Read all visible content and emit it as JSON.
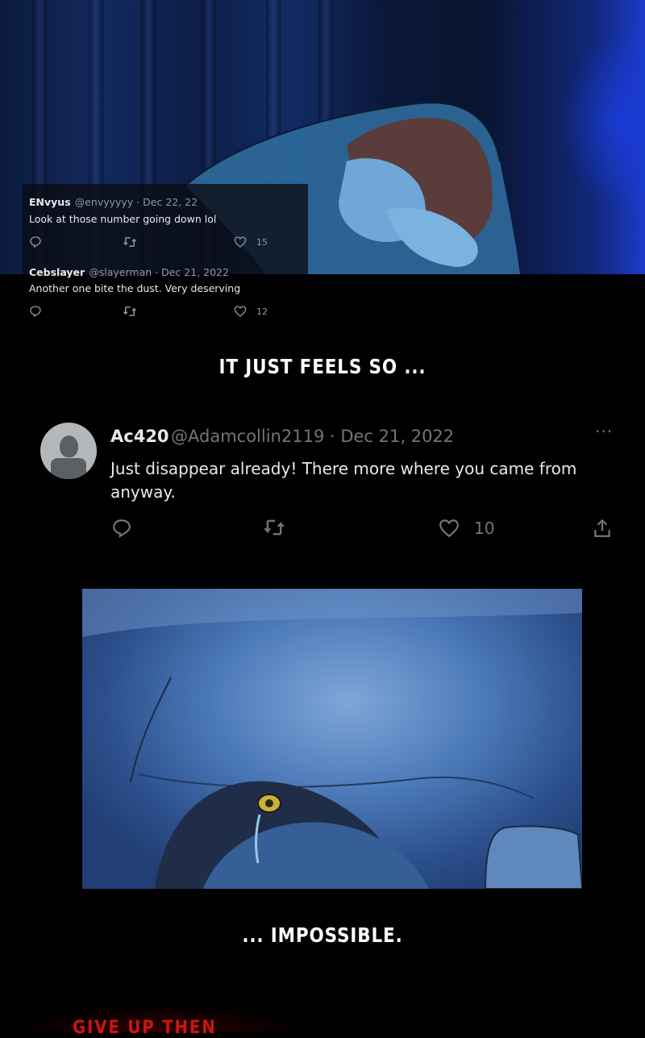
{
  "tweet_small_1": {
    "name": "ENvyus",
    "meta": "@envyyyyy · Dec 22, 22",
    "text": "Look at those number going down lol",
    "like_count": "15"
  },
  "tweet_small_2": {
    "name": "Cebslayer",
    "meta": "@slayerman · Dec 21, 2022",
    "text": "Another one bite the dust. Very deserving",
    "like_count": "12"
  },
  "caption_1": "IT JUST FEELS SO ...",
  "tweet_big": {
    "name": "Ac420",
    "meta": "@Adamcollin2119 · Dec 21, 2022",
    "more": "···",
    "text": "Just disappear already! There more where you came from anyway.",
    "like_count": "10"
  },
  "caption_2": "... IMPOSSIBLE.",
  "bottom_red_text": "GIVE UP THEN",
  "icons": [
    "reply-icon",
    "retweet-icon",
    "like-icon",
    "share-icon",
    "more-icon"
  ],
  "colors": {
    "tweet_text": "#e7e9ea",
    "tweet_meta": "#71767b",
    "red_text": "#c91515"
  }
}
